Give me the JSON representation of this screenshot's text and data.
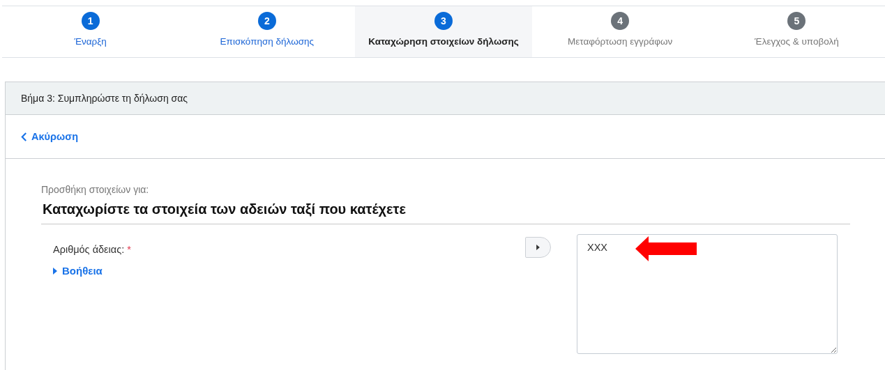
{
  "steps": [
    {
      "number": "1",
      "label": "Έναρξη",
      "kind": "done"
    },
    {
      "number": "2",
      "label": "Επισκόπηση δήλωσης",
      "kind": "done"
    },
    {
      "number": "3",
      "label": "Καταχώρηση στοιχείων δήλωσης",
      "kind": "current"
    },
    {
      "number": "4",
      "label": "Μεταφόρτωση εγγράφων",
      "kind": "todo"
    },
    {
      "number": "5",
      "label": "Έλεγχος & υποβολή",
      "kind": "todo"
    }
  ],
  "panel": {
    "title": "Βήμα 3: Συμπληρώστε τη δήλωση σας",
    "cancel_link": "Ακύρωση",
    "subtitle": "Προσθήκη στοιχείων για:",
    "heading": "Καταχωρίστε τα στοιχεία των αδειών ταξί που κατέχετε",
    "field": {
      "label": "Αριθμός άδειας:",
      "required_mark": "*",
      "help_link": "Βοήθεια",
      "value": "XXX"
    }
  }
}
